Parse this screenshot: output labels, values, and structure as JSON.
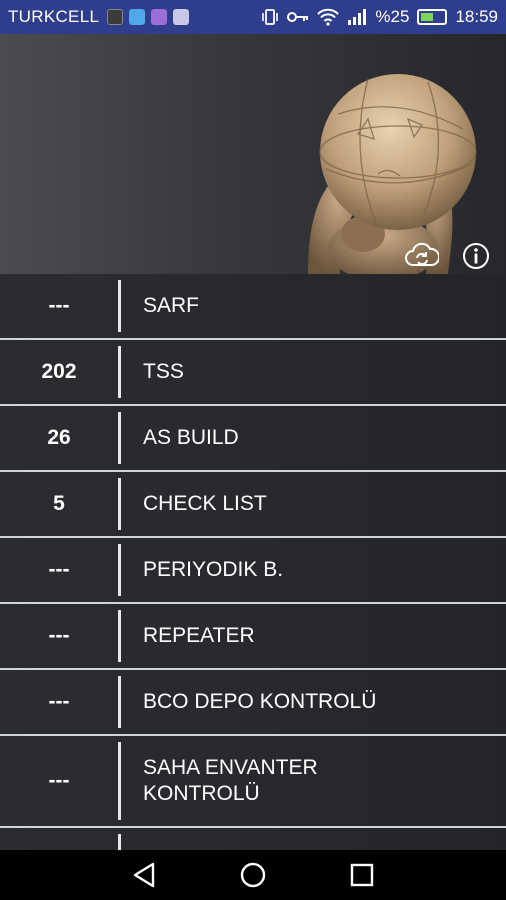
{
  "status_bar": {
    "carrier": "TURKCELL",
    "battery_percent": "%25",
    "time": "18:59",
    "icons": [
      "sim-icon",
      "app-icon",
      "app-icon",
      "gallery-icon",
      "vibrate-icon",
      "key-icon",
      "wifi-icon",
      "signal-icon",
      "battery-charging-icon"
    ]
  },
  "header": {
    "image": "atlas-statue-image",
    "buttons": [
      "cloud-sync-icon",
      "info-icon"
    ]
  },
  "list": {
    "rows": [
      {
        "count": "---",
        "label": "SARF"
      },
      {
        "count": "202",
        "label": "TSS"
      },
      {
        "count": "26",
        "label": "AS BUILD"
      },
      {
        "count": "5",
        "label": "CHECK LIST"
      },
      {
        "count": "---",
        "label": "PERIYODIK B."
      },
      {
        "count": "---",
        "label": "REPEATER"
      },
      {
        "count": "---",
        "label": "BCO DEPO KONTROLÜ"
      },
      {
        "count": "---",
        "label": "SAHA ENVANTER KONTROLÜ"
      }
    ]
  },
  "nav_bar": {
    "buttons": [
      "back-icon",
      "home-icon",
      "recents-icon"
    ]
  },
  "colors": {
    "status_bar": "#2f3e8c",
    "row_bg": "#2b2d31",
    "separator": "#e6e8ea",
    "divider": "#d0d3d8"
  }
}
